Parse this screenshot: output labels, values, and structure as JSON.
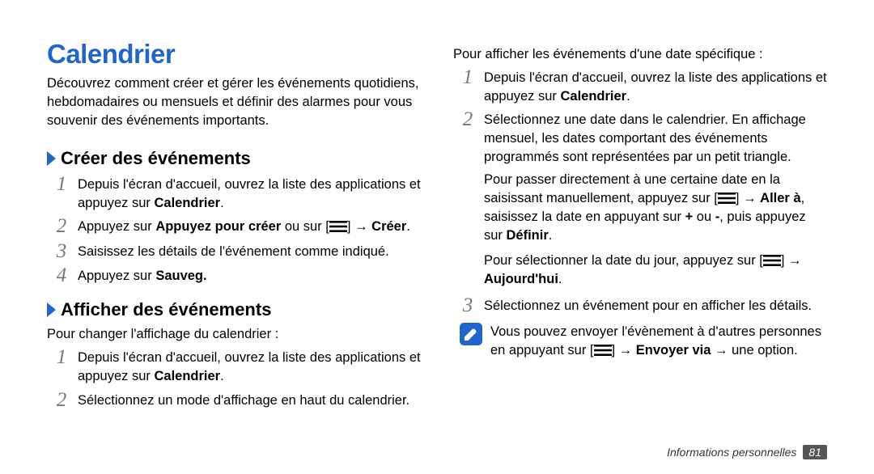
{
  "title": "Calendrier",
  "intro": "Découvrez comment créer et gérer les événements quotidiens, hebdomadaires ou mensuels et définir des alarmes pour vous souvenir des événements importants.",
  "section1": {
    "heading": "Créer des événements",
    "step1_a": "Depuis l'écran d'accueil, ouvrez la liste des applications et appuyez sur ",
    "step1_b": "Calendrier",
    "step1_c": ".",
    "step2_a": "Appuyez sur ",
    "step2_b": "Appuyez pour créer",
    "step2_c": " ou sur [",
    "step2_d": "] → ",
    "step2_e": "Créer",
    "step2_f": ".",
    "step3": "Saisissez les détails de l'événement comme indiqué.",
    "step4_a": "Appuyez sur ",
    "step4_b": "Sauveg."
  },
  "section2": {
    "heading": "Afficher des événements",
    "lead": "Pour changer l'affichage du calendrier :",
    "step1_a": "Depuis l'écran d'accueil, ouvrez la liste des applications et appuyez sur ",
    "step1_b": "Calendrier",
    "step1_c": ".",
    "step2": "Sélectionnez un mode d'affichage en haut du calendrier."
  },
  "right": {
    "lead": "Pour afficher les événements d'une date spécifique :",
    "step1_a": "Depuis l'écran d'accueil, ouvrez la liste des applications et appuyez sur ",
    "step1_b": "Calendrier",
    "step1_c": ".",
    "step2_a": "Sélectionnez une date dans le calendrier. En affichage mensuel, les dates comportant des événements programmés sont représentées par un petit triangle.",
    "step2_b1": "Pour passer directement à une certaine date en la saisissant manuellement, appuyez sur [",
    "step2_b2": "] → ",
    "step2_b3": "Aller à",
    "step2_b4": ", saisissez la date en appuyant sur ",
    "step2_b5": "+",
    "step2_b6": " ou ",
    "step2_b7": "-",
    "step2_b8": ", puis appuyez sur ",
    "step2_b9": "Définir",
    "step2_b10": ".",
    "step2_c1": "Pour sélectionner la date du jour, appuyez sur [",
    "step2_c2": "] → ",
    "step2_c3": "Aujourd'hui",
    "step2_c4": ".",
    "step3": "Sélectionnez un événement pour en afficher les détails.",
    "note_a": "Vous pouvez envoyer l'évènement à d'autres personnes en appuyant sur [",
    "note_b": "] → ",
    "note_c": "Envoyer via",
    "note_d": " → une option."
  },
  "footer": {
    "section": "Informations personnelles",
    "page": "81"
  }
}
